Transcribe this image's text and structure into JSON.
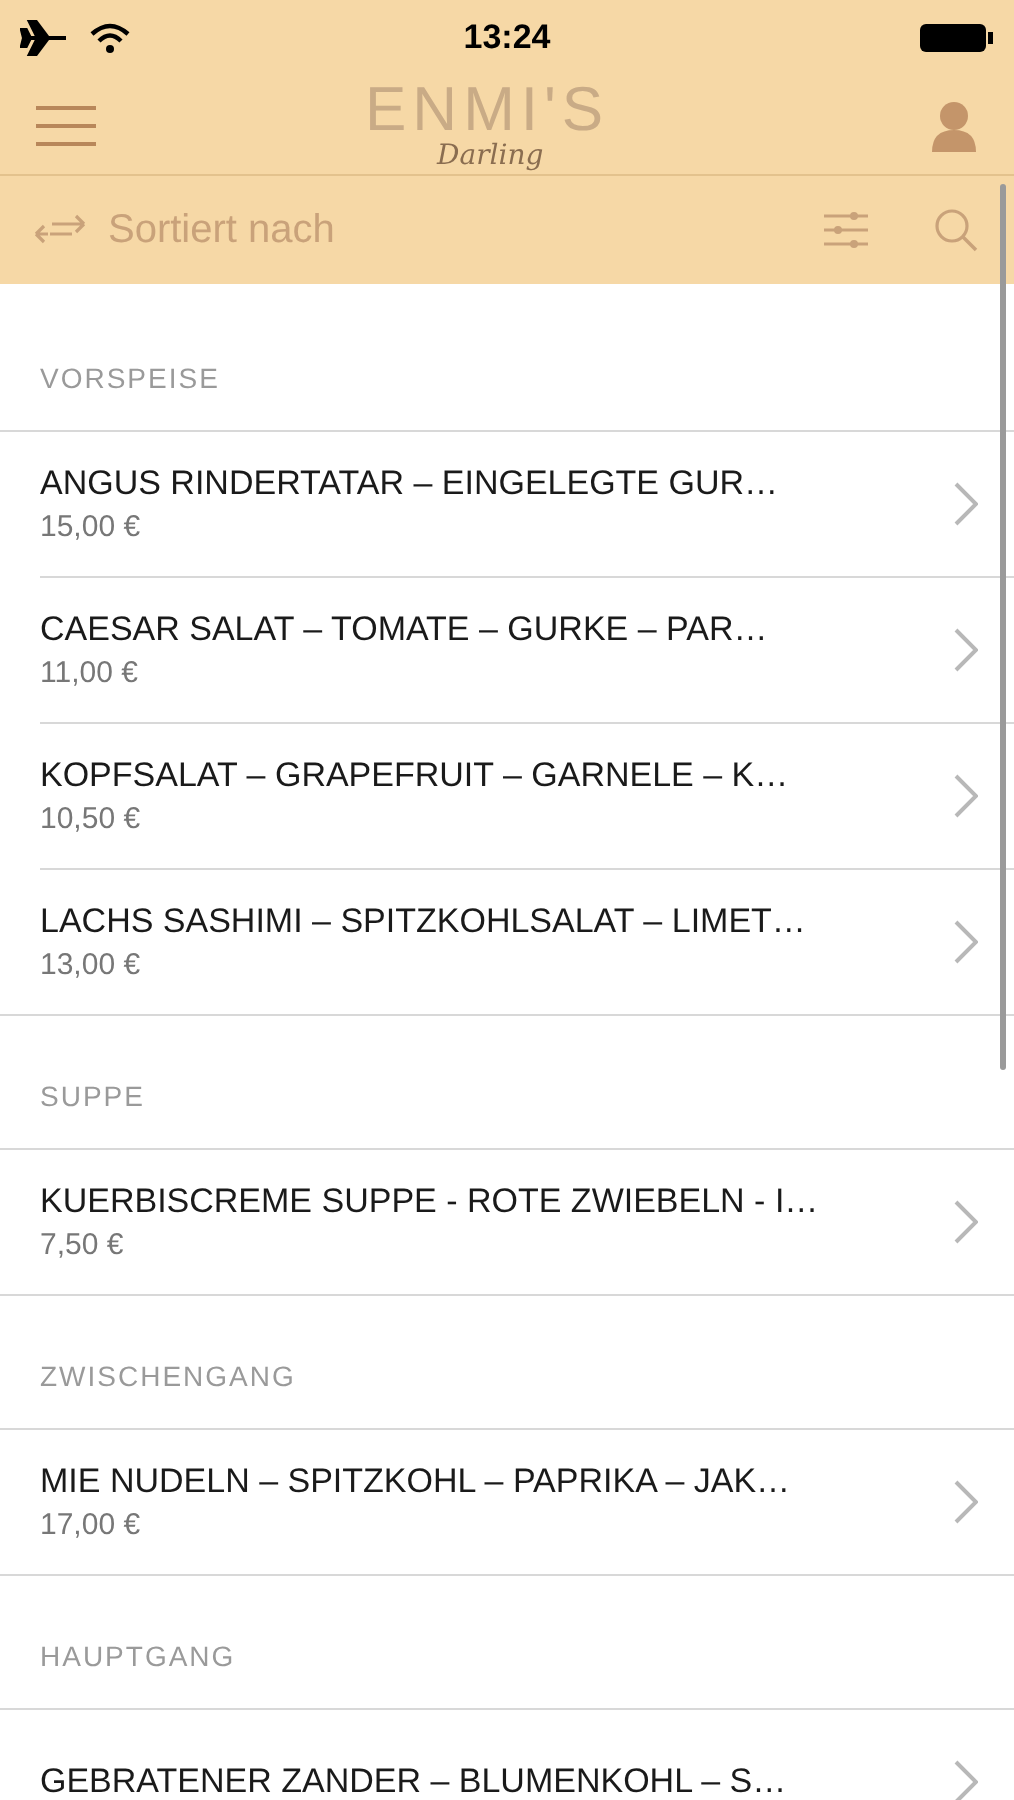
{
  "status_bar": {
    "time": "13:24"
  },
  "header": {
    "logo": "ENMI'S",
    "logo_script": "Darling"
  },
  "sort_bar": {
    "label": "Sortiert nach"
  },
  "sections": [
    {
      "title": "VORSPEISE",
      "items": [
        {
          "name": "ANGUS RINDERTATAR – EINGELEGTE GUR…",
          "price": "15,00 €"
        },
        {
          "name": "CAESAR SALAT – TOMATE – GURKE – PAR…",
          "price": "11,00 €"
        },
        {
          "name": "KOPFSALAT – GRAPEFRUIT – GARNELE – K…",
          "price": "10,50 €"
        },
        {
          "name": "LACHS SASHIMI – SPITZKOHLSALAT – LIMET…",
          "price": "13,00 €"
        }
      ]
    },
    {
      "title": "SUPPE",
      "items": [
        {
          "name": "KUERBISCREME SUPPE - ROTE ZWIEBELN - I…",
          "price": "7,50 €"
        }
      ]
    },
    {
      "title": "ZWISCHENGANG",
      "items": [
        {
          "name": "MIE NUDELN – SPITZKOHL – PAPRIKA – JAK…",
          "price": "17,00 €"
        }
      ]
    },
    {
      "title": "HAUPTGANG",
      "items": [
        {
          "name": "GEBRATENER ZANDER – BLUMENKOHL – S…"
        }
      ]
    }
  ]
}
